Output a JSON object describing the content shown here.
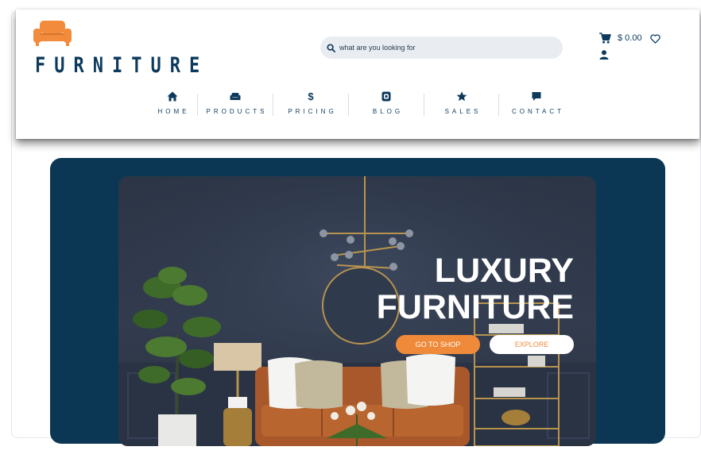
{
  "brand": {
    "name": "FURNITURE",
    "accent": "#f28b3c",
    "primary": "#0d3a5c"
  },
  "search": {
    "placeholder": "what are you looking for",
    "icon": "search-icon"
  },
  "header": {
    "cart_price": "$ 0.00",
    "cart_icon": "cart-icon",
    "wishlist_icon": "heart-icon",
    "account_icon": "user-icon"
  },
  "nav": {
    "items": [
      {
        "label": "HOME",
        "icon": "home-icon"
      },
      {
        "label": "PRODUCTS",
        "icon": "sofa-icon"
      },
      {
        "label": "PRICING",
        "icon": "dollar-icon",
        "glyph": "$"
      },
      {
        "label": "BLOG",
        "icon": "blog-icon"
      },
      {
        "label": "SALES",
        "icon": "star-icon"
      },
      {
        "label": "CONTACT",
        "icon": "chat-icon"
      }
    ]
  },
  "hero": {
    "title_line1": "LUXURY",
    "title_line2": "FURNITURE",
    "primary_button": "GO TO SHOP",
    "secondary_button": "EXPLORE",
    "panel_color": "#0b3754"
  }
}
